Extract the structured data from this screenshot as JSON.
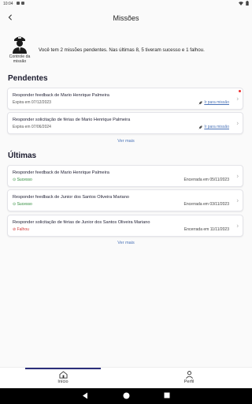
{
  "status_bar": {
    "time": "10:04"
  },
  "header": {
    "title": "Missões"
  },
  "summary": {
    "avatar_label": "Controle da missão",
    "text": "Você tem 2 missões pendentes. Nas últimas 8, 5 tiveram sucesso e 1 falhou."
  },
  "pending": {
    "title": "Pendentes",
    "items": [
      {
        "title": "Responder feedback de Mario Henrique Palmeira",
        "expires": "Expira em 07/12/2023",
        "action": "Ir para missão"
      },
      {
        "title": "Responder solicitação de férias de Mario Henrique Palmeira",
        "expires": "Expira em 07/06/2024",
        "action": "Ir para missão"
      }
    ],
    "see_more": "Ver mais"
  },
  "recent": {
    "title": "Últimas",
    "items": [
      {
        "title": "Responder feedback de Mario Henrique Palmeira",
        "status": "Sucesso",
        "closed": "Encerrada em 05/11/2023"
      },
      {
        "title": "Responder feedback de Junior dos Santos Oliveira Mariano",
        "status": "Sucesso",
        "closed": "Encerrada em 03/11/2023"
      },
      {
        "title": "Responder solicitação de férias de Junior dos Santos Oliveira Mariano",
        "status": "Falhou",
        "closed": "Encerrada em 11/11/2023"
      }
    ],
    "see_more": "Ver mais"
  },
  "bottom_nav": {
    "home": "Início",
    "profile": "Perfil"
  },
  "colors": {
    "accent": "#2b2e7a",
    "link": "#4a73b8",
    "success": "#2e8b3a",
    "fail": "#d03a3a"
  }
}
